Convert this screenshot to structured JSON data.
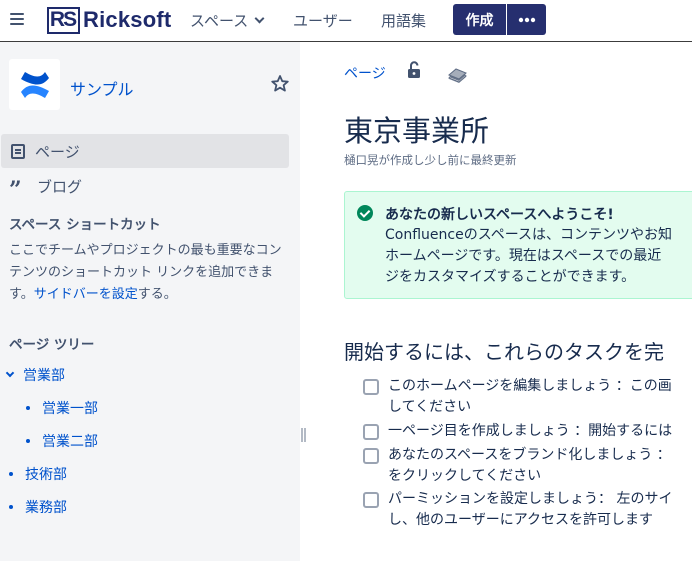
{
  "topbar": {
    "logo_mark": "RS",
    "logo_text": "Ricksoft",
    "nav": {
      "spaces": "スペース",
      "users": "ユーザー",
      "glossary": "用語集"
    },
    "create_label": "作成",
    "more_label": "•••",
    "accent_color": "#262f6f"
  },
  "sidebar": {
    "space_name": "サンプル",
    "nav_pages": "ページ",
    "nav_blog": "ブログ",
    "shortcuts_title": "スペース ショートカット",
    "shortcuts_text_before": "ここでチームやプロジェクトの最も重要なコンテンツのショートカット リンクを追加できます。",
    "shortcuts_link": "サイドバーを設定",
    "shortcuts_text_after": "する。",
    "tree_title": "ページ ツリー",
    "tree": {
      "item0": "営業部",
      "item1": "営業一部",
      "item2": "営業二部",
      "item3": "技術部",
      "item4": "業務部"
    }
  },
  "main": {
    "breadcrumb": "ページ",
    "title": "東京事業所",
    "byline": "樋口晃が作成し少し前に最終更新",
    "panel": {
      "title": "あなたの新しいスペースへようこそ!",
      "line1": "Confluenceのスペースは、コンテンツやお知",
      "line2": "ホームページです。現在はスペースでの最近",
      "line3": "ジをカスタマイズすることができます。"
    },
    "tasks_heading": "開始するには、これらのタスクを完",
    "tasks": {
      "t1": "このホームページを編集しましょう ：この画\nしてください",
      "t2": "一ページ目を作成しましょう ：開始するには",
      "t3": "あなたのスペースをブランド化しましょう ：\nをクリックしてください",
      "t4": "パーミッションを設定しましょう： 左のサイ\nし、他のユーザーにアクセスを許可します"
    }
  }
}
